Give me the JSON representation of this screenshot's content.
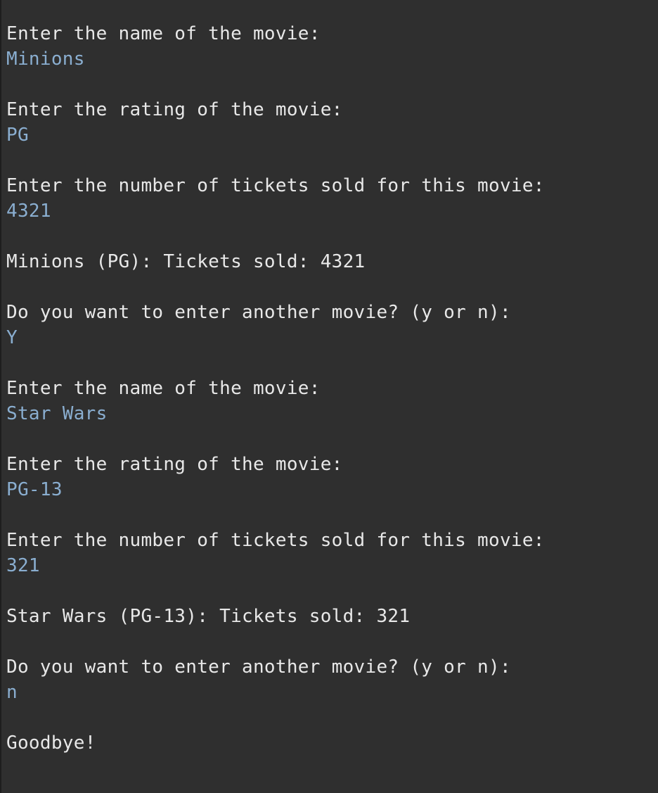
{
  "colors": {
    "background": "#2f2f2f",
    "output_text": "#e8e8e8",
    "input_text": "#8aaed0"
  },
  "console": {
    "lines": [
      {
        "kind": "output",
        "text": "Enter the name of the movie:"
      },
      {
        "kind": "input",
        "text": "Minions"
      },
      {
        "kind": "blank",
        "text": ""
      },
      {
        "kind": "output",
        "text": "Enter the rating of the movie:"
      },
      {
        "kind": "input",
        "text": "PG"
      },
      {
        "kind": "blank",
        "text": ""
      },
      {
        "kind": "output",
        "text": "Enter the number of tickets sold for this movie:"
      },
      {
        "kind": "input",
        "text": "4321"
      },
      {
        "kind": "blank",
        "text": ""
      },
      {
        "kind": "output",
        "text": "Minions (PG): Tickets sold: 4321"
      },
      {
        "kind": "blank",
        "text": ""
      },
      {
        "kind": "output",
        "text": "Do you want to enter another movie? (y or n):"
      },
      {
        "kind": "input",
        "text": "Y"
      },
      {
        "kind": "blank",
        "text": ""
      },
      {
        "kind": "output",
        "text": "Enter the name of the movie:"
      },
      {
        "kind": "input",
        "text": "Star Wars"
      },
      {
        "kind": "blank",
        "text": ""
      },
      {
        "kind": "output",
        "text": "Enter the rating of the movie:"
      },
      {
        "kind": "input",
        "text": "PG-13"
      },
      {
        "kind": "blank",
        "text": ""
      },
      {
        "kind": "output",
        "text": "Enter the number of tickets sold for this movie:"
      },
      {
        "kind": "input",
        "text": "321"
      },
      {
        "kind": "blank",
        "text": ""
      },
      {
        "kind": "output",
        "text": "Star Wars (PG-13): Tickets sold: 321"
      },
      {
        "kind": "blank",
        "text": ""
      },
      {
        "kind": "output",
        "text": "Do you want to enter another movie? (y or n):"
      },
      {
        "kind": "input",
        "text": "n"
      },
      {
        "kind": "blank",
        "text": ""
      },
      {
        "kind": "output",
        "text": "Goodbye!"
      }
    ]
  }
}
